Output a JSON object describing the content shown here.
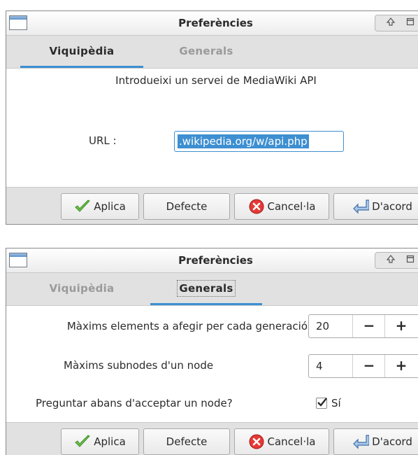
{
  "window1": {
    "title": "Preferències",
    "tabs": [
      {
        "label": "Viquipèdia",
        "active": true
      },
      {
        "label": "Generals",
        "active": false
      }
    ],
    "heading": "Introdueixi un servei de MediaWiki API",
    "url_label": "URL :",
    "url_value": ".wikipedia.org/w/api.php"
  },
  "window2": {
    "title": "Preferències",
    "tabs": [
      {
        "label": "Viquipèdia",
        "active": false
      },
      {
        "label": "Generals",
        "active": true
      }
    ],
    "max_elements_label": "Màxims elements a afegir per cada generació",
    "max_elements_value": "20",
    "max_subnodes_label": "Màxims subnodes d'un node",
    "max_subnodes_value": "4",
    "ask_label": "Preguntar abans d'acceptar un node?",
    "ask_checkbox_label": "Sí",
    "ask_checked": true
  },
  "buttons": {
    "apply": "Aplica",
    "default": "Defecte",
    "cancel": "Cancel·la",
    "ok": "D'acord",
    "decrement": "−",
    "increment": "+"
  },
  "titlebar_icons": [
    "roll-up-icon",
    "maximize-icon"
  ],
  "colors": {
    "accent": "#3d8fd1",
    "bar_bg": "#e1e1e1",
    "cancel_red": "#e53935",
    "check_green": "#6cc24a"
  }
}
